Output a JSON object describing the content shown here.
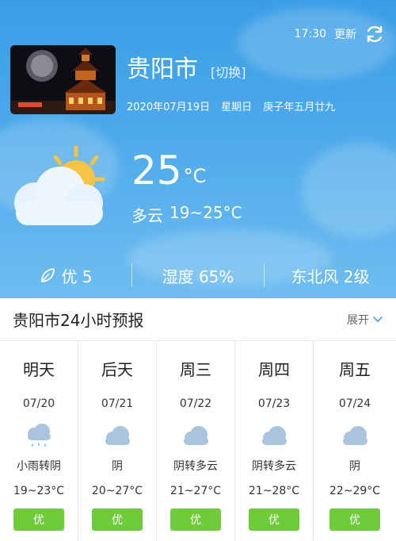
{
  "header": {
    "time": "17:30",
    "refresh_label": "更新",
    "city": "贵阳市",
    "switch_label": "[切换]",
    "date": "2020年07月19日",
    "weekday": "星期日",
    "lunar": "庚子年五月廿九"
  },
  "current": {
    "temperature": "25",
    "unit": "°C",
    "condition": "多云",
    "range": "19~25°C"
  },
  "stats": {
    "aqi": "优 5",
    "humidity": "湿度 65%",
    "wind": "东北风 2级"
  },
  "forecast_section": {
    "title": "贵阳市24小时预报",
    "expand_label": "展开"
  },
  "days": [
    {
      "name": "明天",
      "date": "07/20",
      "icon": "light-rain-icon",
      "condition": "小雨转阴",
      "temp": "19~23°C",
      "aqi": "优"
    },
    {
      "name": "后天",
      "date": "07/21",
      "icon": "overcast-icon",
      "condition": "阴",
      "temp": "20~27°C",
      "aqi": "优"
    },
    {
      "name": "周三",
      "date": "07/22",
      "icon": "overcast-icon",
      "condition": "阴转多云",
      "temp": "21~27°C",
      "aqi": "优"
    },
    {
      "name": "周四",
      "date": "07/23",
      "icon": "overcast-icon",
      "condition": "阴转多云",
      "temp": "21~28°C",
      "aqi": "优"
    },
    {
      "name": "周五",
      "date": "07/24",
      "icon": "overcast-icon",
      "condition": "阴",
      "temp": "22~29°C",
      "aqi": "优"
    }
  ],
  "colors": {
    "sky": "#4aa8ea",
    "aqi_good": "#6ecb3a",
    "cloud_icon": "#a9c4dd",
    "rain_drop": "#4aa8ea"
  }
}
